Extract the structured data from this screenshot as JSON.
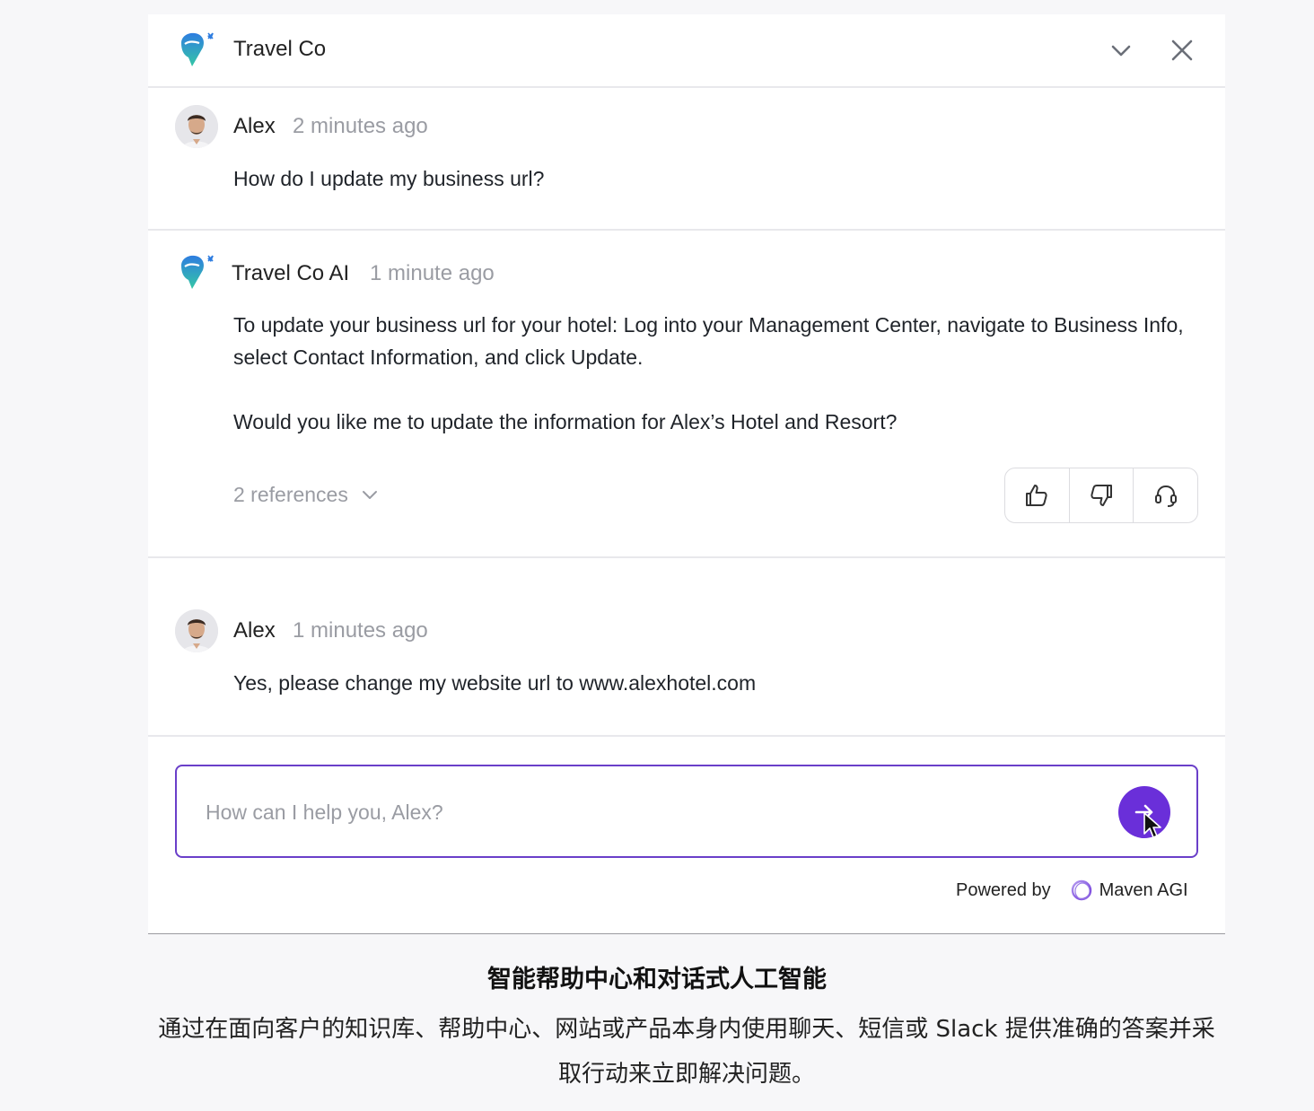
{
  "header": {
    "title": "Travel Co"
  },
  "messages": [
    {
      "sender": "Alex",
      "time": "2 minutes ago",
      "text": "How do I update my business url?"
    },
    {
      "sender": "Travel Co AI",
      "time": "1 minute ago",
      "text_p1": "To update your business url for your hotel: Log into your Management Center, navigate to Business Info, select Contact Information, and click Update.",
      "text_p2": "Would you like me to update the information for Alex’s Hotel and Resort?",
      "references_label": "2 references"
    },
    {
      "sender": "Alex",
      "time": "1 minutes ago",
      "text": "Yes, please change my website url to www.alexhotel.com"
    }
  ],
  "input": {
    "placeholder": "How can I help you, Alex?",
    "value": ""
  },
  "footer": {
    "powered_by": "Powered by",
    "brand": "Maven AGI"
  },
  "caption": {
    "title": "智能帮助中心和对话式人工智能",
    "body": "通过在面向客户的知识库、帮助中心、网站或产品本身内使用聊天、短信或 Slack 提供准确的答案并采取行动来立即解决问题。"
  },
  "colors": {
    "accent": "#6a2fd9",
    "input_border": "#6a3fc9",
    "muted_text": "#9a9ca3",
    "divider": "#e8e8ec"
  },
  "icons": {
    "logo": "travel-co-logo",
    "collapse": "chevron-down-icon",
    "close": "close-icon",
    "thumbs_up": "thumbs-up-icon",
    "thumbs_down": "thumbs-down-icon",
    "support": "headset-icon",
    "send": "arrow-right-icon"
  }
}
